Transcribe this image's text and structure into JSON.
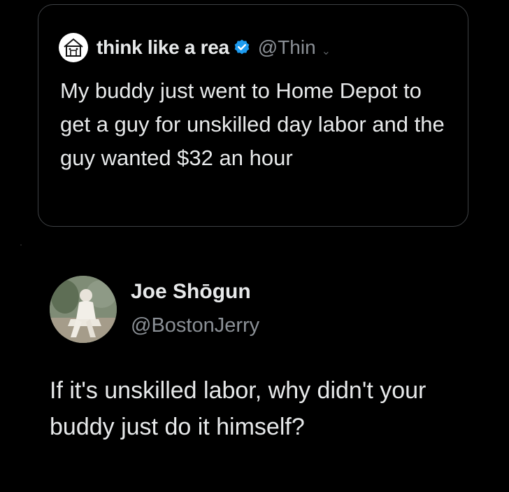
{
  "quoted_tweet": {
    "author_name": "think like a rea",
    "handle": "@Thin",
    "verified": true,
    "text": "My buddy just went to Home Depot to get a guy for unskilled day labor and the guy wanted $32 an hour"
  },
  "reply_tweet": {
    "author_name": "Joe Shōgun",
    "handle": "@BostonJerry",
    "text": "If it's unskilled labor, why didn't your buddy just do it himself?"
  },
  "colors": {
    "background": "#000000",
    "primary_text": "#e7e9ea",
    "secondary_text": "#8b9096",
    "card_border": "#3e4144",
    "verified_blue": "#1d9bf0"
  },
  "icons": {
    "verified": "verified-badge-icon",
    "quote_avatar": "house-logo-icon"
  }
}
